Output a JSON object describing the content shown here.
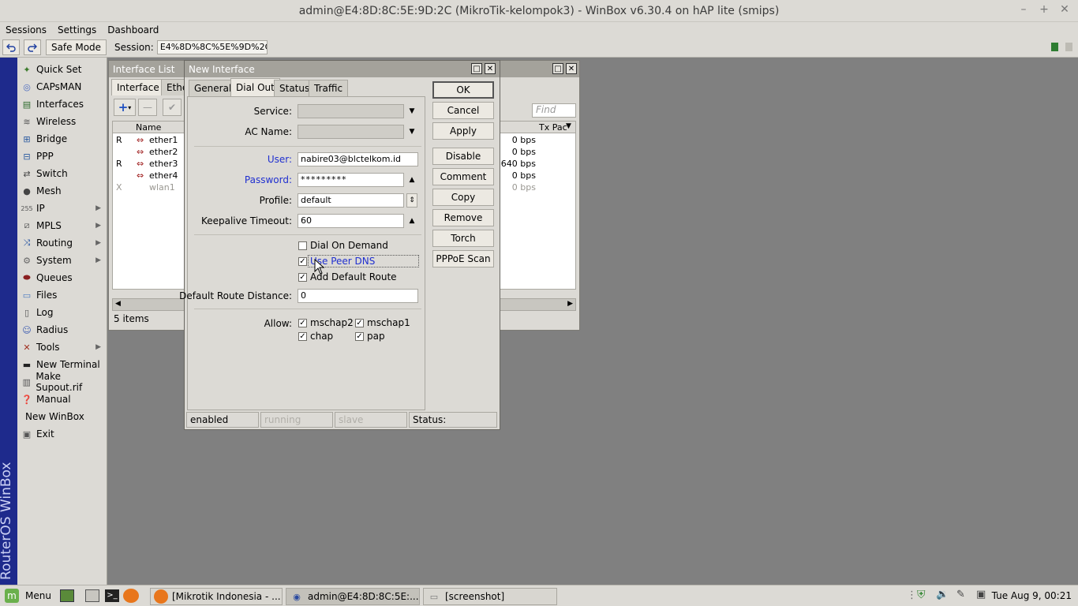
{
  "window": {
    "title": "admin@E4:8D:8C:5E:9D:2C (MikroTik-kelompok3) - WinBox v6.30.4 on hAP lite (smips)"
  },
  "menubar": {
    "items": [
      "Sessions",
      "Settings",
      "Dashboard"
    ]
  },
  "toolbar": {
    "safe_mode": "Safe Mode",
    "session_label": "Session:",
    "session_value": "E4%8D%8C%5E%9D%2C"
  },
  "strip_text": "RouterOS WinBox",
  "sidebar": {
    "items": [
      {
        "label": "Quick Set",
        "icon": "quick-set-icon",
        "has_submenu": false
      },
      {
        "label": "CAPsMAN",
        "icon": "capsman-icon",
        "has_submenu": false
      },
      {
        "label": "Interfaces",
        "icon": "interfaces-icon",
        "has_submenu": false
      },
      {
        "label": "Wireless",
        "icon": "wireless-icon",
        "has_submenu": false
      },
      {
        "label": "Bridge",
        "icon": "bridge-icon",
        "has_submenu": false
      },
      {
        "label": "PPP",
        "icon": "ppp-icon",
        "has_submenu": false
      },
      {
        "label": "Switch",
        "icon": "switch-icon",
        "has_submenu": false
      },
      {
        "label": "Mesh",
        "icon": "mesh-icon",
        "has_submenu": false
      },
      {
        "label": "IP",
        "icon": "ip-icon",
        "has_submenu": true
      },
      {
        "label": "MPLS",
        "icon": "mpls-icon",
        "has_submenu": true
      },
      {
        "label": "Routing",
        "icon": "routing-icon",
        "has_submenu": true
      },
      {
        "label": "System",
        "icon": "system-icon",
        "has_submenu": true
      },
      {
        "label": "Queues",
        "icon": "queues-icon",
        "has_submenu": false
      },
      {
        "label": "Files",
        "icon": "files-icon",
        "has_submenu": false
      },
      {
        "label": "Log",
        "icon": "log-icon",
        "has_submenu": false
      },
      {
        "label": "Radius",
        "icon": "radius-icon",
        "has_submenu": false
      },
      {
        "label": "Tools",
        "icon": "tools-icon",
        "has_submenu": true
      },
      {
        "label": "New Terminal",
        "icon": "terminal-icon",
        "has_submenu": false
      },
      {
        "label": "Make Supout.rif",
        "icon": "supout-icon",
        "has_submenu": false
      },
      {
        "label": "Manual",
        "icon": "manual-icon",
        "has_submenu": false
      },
      {
        "label": "New WinBox",
        "icon": "",
        "has_submenu": false
      },
      {
        "label": "Exit",
        "icon": "exit-icon",
        "has_submenu": false
      }
    ]
  },
  "interface_list": {
    "title": "Interface List",
    "tabs": [
      "Interface",
      "Ethe"
    ],
    "find_placeholder": "Find",
    "columns": {
      "name": "Name",
      "tx": "Tx Pac"
    },
    "rows": [
      {
        "flag": "R",
        "name": "ether1",
        "rate": "0 bps",
        "disabled": false
      },
      {
        "flag": "",
        "name": "ether2",
        "rate": "0 bps",
        "disabled": false
      },
      {
        "flag": "R",
        "name": "ether3",
        "rate": "1640 bps",
        "disabled": false
      },
      {
        "flag": "",
        "name": "ether4",
        "rate": "0 bps",
        "disabled": false
      },
      {
        "flag": "X",
        "name": "wlan1",
        "rate": "0 bps",
        "disabled": true
      }
    ],
    "status": "5 items"
  },
  "dialog": {
    "title": "New Interface",
    "tabs": [
      "General",
      "Dial Out",
      "Status",
      "Traffic"
    ],
    "active_tab": "Dial Out",
    "fields": {
      "service_label": "Service:",
      "service_value": "",
      "ac_name_label": "AC Name:",
      "ac_name_value": "",
      "user_label": "User:",
      "user_value": "nabire03@blctelkom.id",
      "password_label": "Password:",
      "password_value": "*********",
      "profile_label": "Profile:",
      "profile_value": "default",
      "keepalive_label": "Keepalive Timeout:",
      "keepalive_value": "60",
      "route_distance_label": "Default Route Distance:",
      "route_distance_value": "0",
      "allow_label": "Allow:"
    },
    "checkboxes": {
      "dial_on_demand": {
        "label": "Dial On Demand",
        "checked": false
      },
      "use_peer_dns": {
        "label": "Use Peer DNS",
        "checked": true
      },
      "add_default_route": {
        "label": "Add Default Route",
        "checked": true
      },
      "mschap2": {
        "label": "mschap2",
        "checked": true
      },
      "mschap1": {
        "label": "mschap1",
        "checked": true
      },
      "chap": {
        "label": "chap",
        "checked": true
      },
      "pap": {
        "label": "pap",
        "checked": true
      }
    },
    "buttons": [
      "OK",
      "Cancel",
      "Apply",
      "Disable",
      "Comment",
      "Copy",
      "Remove",
      "Torch",
      "PPPoE Scan"
    ],
    "status_bar": {
      "enabled": "enabled",
      "running": "running",
      "slave": "slave",
      "status": "Status:"
    }
  },
  "taskbar": {
    "menu": "Menu",
    "items": [
      "[Mikrotik Indonesia - ...",
      "admin@E4:8D:8C:5E:...",
      "[screenshot]"
    ],
    "clock": "Tue Aug  9, 00:21"
  }
}
